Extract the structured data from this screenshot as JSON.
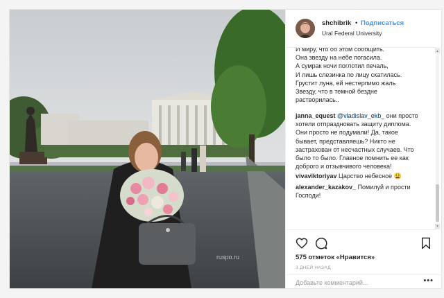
{
  "post": {
    "username": "shchibrik",
    "dot": "•",
    "follow_label": "Подписаться",
    "location": "Ural Federal University",
    "watermark": "ruspo.ru",
    "photo_alt": "photo"
  },
  "caption": {
    "lines": [
      "И миру, что об этом сообщить.",
      "Она звезду на небе погасила.",
      "А сумрак ночи поглотил печаль,",
      "И лишь слезинка по лицу скатилась.",
      "Грустит луна, ей нестерпимо жаль",
      "Звезду, что в темной бездне",
      "растворилась.."
    ]
  },
  "comments": [
    {
      "user": "janna_equest",
      "mention": "@vladislav_ekb_",
      "lines": [
        " они просто",
        "хотели отпраздновать защиту диплома.",
        "Они просто не подумали! Да, такое",
        "бывает, представляешь? Никто не",
        "застрахован от несчастных случаев. Что",
        "было то было. Главное помнить ее как",
        "доброго и отзывчивого человека!"
      ]
    },
    {
      "user": "vivaviktoriyav",
      "text": " Царство небесное 😩"
    },
    {
      "user": "alexander_kazakov_",
      "text": " Помилуй и прости",
      "line2": "Господи!"
    }
  ],
  "actions": {
    "like_icon": "heart-icon",
    "comment_icon": "comment-icon",
    "save_icon": "bookmark-icon",
    "likes_text": "575 отметок «Нравится»",
    "time_ago": "3 ДНЕЙ НАЗАД",
    "comment_placeholder": "Добавьте комментарий...",
    "more_label": "•••"
  },
  "scroll": {
    "up": "▲",
    "down": "▼"
  },
  "colors": {
    "link": "#3897f0",
    "text": "#262626",
    "muted": "#999999"
  }
}
